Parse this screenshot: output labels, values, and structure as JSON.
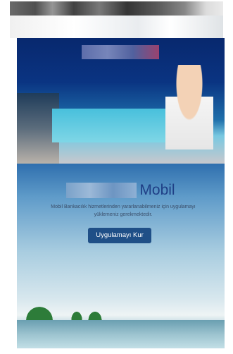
{
  "promo": {
    "brand_suffix": "Mobil",
    "message": "Mobil Bankacılık hizmetlerinden yararlanabilmeniz için uygulamayı yüklemeniz gerekmektedir.",
    "install_button": "Uygulamayı Kur"
  },
  "colors": {
    "brand_text": "#1f3f86",
    "button_bg": "#1f4f87"
  }
}
